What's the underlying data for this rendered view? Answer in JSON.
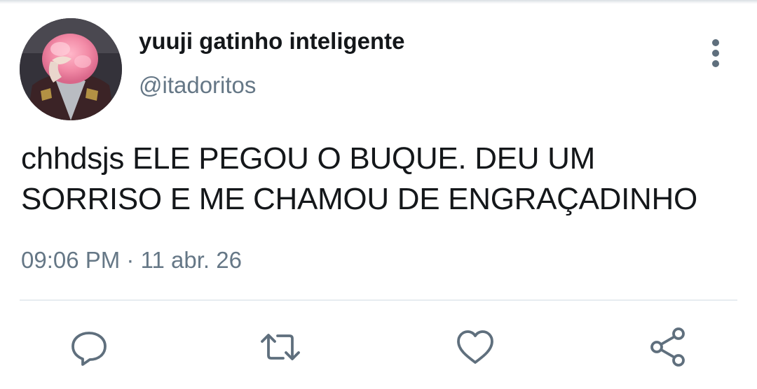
{
  "tweet": {
    "display_name": "yuuji gatinho inteligente",
    "handle": "@itadoritos",
    "text_lines": [
      "chhdsjs ELE PEGOU O BUQUE. DEU UM",
      "SORRISO E ME CHAMOU DE ENGRAÇADINHO"
    ],
    "timestamp": "09:06 PM · 11 abr. 26"
  },
  "icons": {
    "menu": "more-vertical-icon",
    "reply": "reply-icon",
    "retweet": "retweet-icon",
    "like": "heart-icon",
    "share": "share-icon"
  },
  "colors": {
    "text_primary": "#14171a",
    "text_secondary": "#657786",
    "icon": "#5f6f7d",
    "divider": "#e6ecf0"
  }
}
